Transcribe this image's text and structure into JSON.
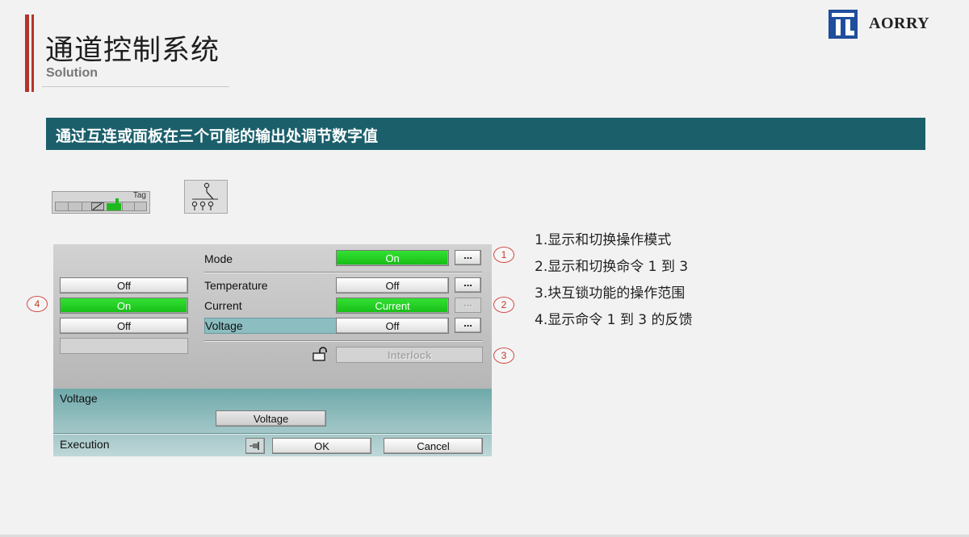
{
  "header": {
    "title": "通道控制系统",
    "subtitle": "Solution",
    "logo_text": "AORRY"
  },
  "banner": {
    "text": "通过互连或面板在三个可能的输出处调节数字值"
  },
  "faceplate": {
    "tag_label": "Tag"
  },
  "panel": {
    "mode_label": "Mode",
    "mode_value": "On",
    "dots_label": "...",
    "feedback": [
      "Off",
      "On",
      "Off"
    ],
    "commands": [
      {
        "label": "Temperature",
        "value": "Off"
      },
      {
        "label": "Current",
        "value": "Current"
      },
      {
        "label": "Voltage",
        "value": "Off"
      }
    ],
    "interlock_label": "Interlock",
    "voltage_section_label": "Voltage",
    "voltage_button": "Voltage",
    "execution_label": "Execution",
    "ok_label": "OK",
    "cancel_label": "Cancel",
    "active_color": "#1ec81e",
    "highlight_color": "#8cbdc0"
  },
  "callouts": [
    "1",
    "2",
    "3",
    "4"
  ],
  "notes": [
    "1.显示和切换操作模式",
    "2.显示和切换命令 1 到 3",
    "3.块互锁功能的操作范围",
    "4.显示命令 1 到 3 的反馈"
  ],
  "colors": {
    "accent": "#b5332a",
    "banner": "#1b5f6b",
    "logo_blue": "#1f4e9c"
  }
}
